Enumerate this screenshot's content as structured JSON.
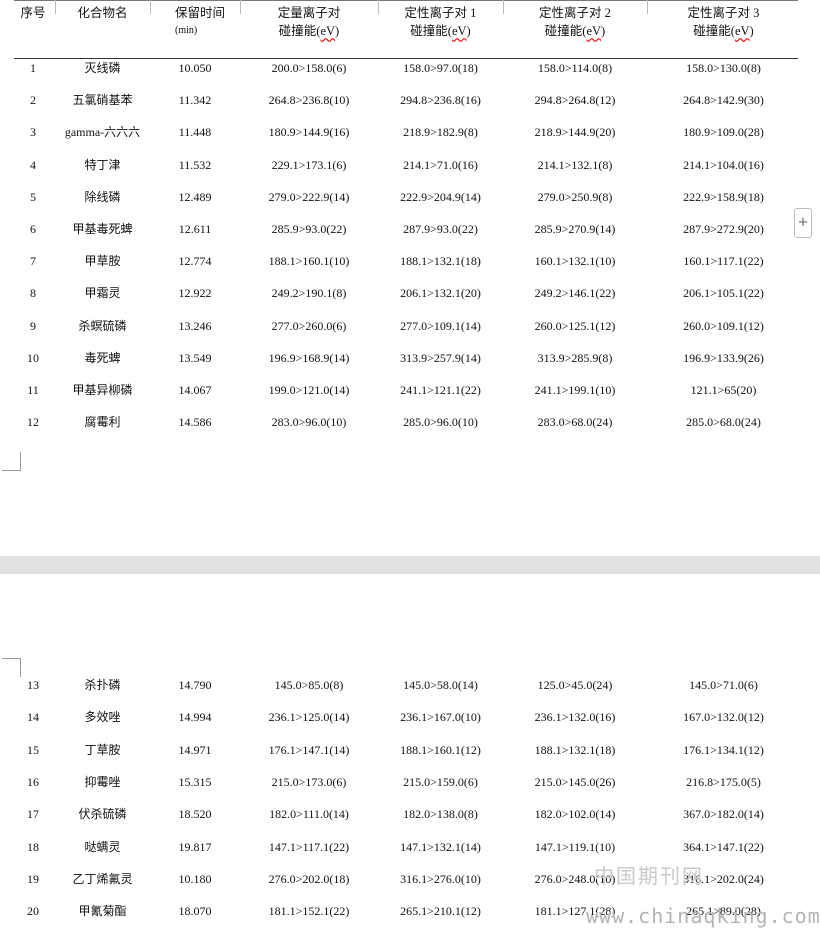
{
  "headers": {
    "no": "序号",
    "name": "化合物名",
    "rt": "保留时间",
    "rt_unit": "(min)",
    "quant_line1": "定量离子对",
    "quant_line2": "碰撞能(",
    "quant_ev": "eV",
    "quant_close": ")",
    "q1_line1": "定性离子对 1",
    "q1_line2": "碰撞能(",
    "q1_ev": "eV",
    "q1_close": ")",
    "q2_line1": "定性离子对 2",
    "q2_line2": "碰撞能(",
    "q2_ev": "eV",
    "q2_close": ")",
    "q3_line1": "定性离子对 3",
    "q3_line2": "碰撞能(",
    "q3_ev": "eV",
    "q3_close": ")"
  },
  "rows_page1": [
    [
      "1",
      "灭线磷",
      "10.050",
      "200.0>158.0(6)",
      "158.0>97.0(18)",
      "158.0>114.0(8)",
      "158.0>130.0(8)"
    ],
    [
      "2",
      "五氯硝基苯",
      "11.342",
      "264.8>236.8(10)",
      "294.8>236.8(16)",
      "294.8>264.8(12)",
      "264.8>142.9(30)"
    ],
    [
      "3",
      "gamma-六六六",
      "11.448",
      "180.9>144.9(16)",
      "218.9>182.9(8)",
      "218.9>144.9(20)",
      "180.9>109.0(28)"
    ],
    [
      "4",
      "特丁津",
      "11.532",
      "229.1>173.1(6)",
      "214.1>71.0(16)",
      "214.1>132.1(8)",
      "214.1>104.0(16)"
    ],
    [
      "5",
      "除线磷",
      "12.489",
      "279.0>222.9(14)",
      "222.9>204.9(14)",
      "279.0>250.9(8)",
      "222.9>158.9(18)"
    ],
    [
      "6",
      "甲基毒死蜱",
      "12.611",
      "285.9>93.0(22)",
      "287.9>93.0(22)",
      "285.9>270.9(14)",
      "287.9>272.9(20)"
    ],
    [
      "7",
      "甲草胺",
      "12.774",
      "188.1>160.1(10)",
      "188.1>132.1(18)",
      "160.1>132.1(10)",
      "160.1>117.1(22)"
    ],
    [
      "8",
      "甲霜灵",
      "12.922",
      "249.2>190.1(8)",
      "206.1>132.1(20)",
      "249.2>146.1(22)",
      "206.1>105.1(22)"
    ],
    [
      "9",
      "杀螟硫磷",
      "13.246",
      "277.0>260.0(6)",
      "277.0>109.1(14)",
      "260.0>125.1(12)",
      "260.0>109.1(12)"
    ],
    [
      "10",
      "毒死蜱",
      "13.549",
      "196.9>168.9(14)",
      "313.9>257.9(14)",
      "313.9>285.9(8)",
      "196.9>133.9(26)"
    ],
    [
      "11",
      "甲基异柳磷",
      "14.067",
      "199.0>121.0(14)",
      "241.1>121.1(22)",
      "241.1>199.1(10)",
      "121.1>65(20)"
    ],
    [
      "12",
      "腐霉利",
      "14.586",
      "283.0>96.0(10)",
      "285.0>96.0(10)",
      "283.0>68.0(24)",
      "285.0>68.0(24)"
    ]
  ],
  "rows_page2": [
    [
      "13",
      "杀扑磷",
      "14.790",
      "145.0>85.0(8)",
      "145.0>58.0(14)",
      "125.0>45.0(24)",
      "145.0>71.0(6)"
    ],
    [
      "14",
      "多效唑",
      "14.994",
      "236.1>125.0(14)",
      "236.1>167.0(10)",
      "236.1>132.0(16)",
      "167.0>132.0(12)"
    ],
    [
      "15",
      "丁草胺",
      "14.971",
      "176.1>147.1(14)",
      "188.1>160.1(12)",
      "188.1>132.1(18)",
      "176.1>134.1(12)"
    ],
    [
      "16",
      "抑霉唑",
      "15.315",
      "215.0>173.0(6)",
      "215.0>159.0(6)",
      "215.0>145.0(26)",
      "216.8>175.0(5)"
    ],
    [
      "17",
      "伏杀硫磷",
      "18.520",
      "182.0>111.0(14)",
      "182.0>138.0(8)",
      "182.0>102.0(14)",
      "367.0>182.0(14)"
    ],
    [
      "18",
      "哒螨灵",
      "19.817",
      "147.1>117.1(22)",
      "147.1>132.1(14)",
      "147.1>119.1(10)",
      "364.1>147.1(22)"
    ],
    [
      "19",
      "乙丁烯氟灵",
      "10.180",
      "276.0>202.0(18)",
      "316.1>276.0(10)",
      "276.0>248.0(10)",
      "316.1>202.0(24)"
    ],
    [
      "20",
      "甲氰菊酯",
      "18.070",
      "181.1>152.1(22)",
      "265.1>210.1(12)",
      "181.1>127.1(28)",
      "265.1>89.0(28)"
    ]
  ],
  "side_button": "+",
  "watermark_cn": "中国期刊网",
  "watermark_url": "www.chinaqking.com"
}
